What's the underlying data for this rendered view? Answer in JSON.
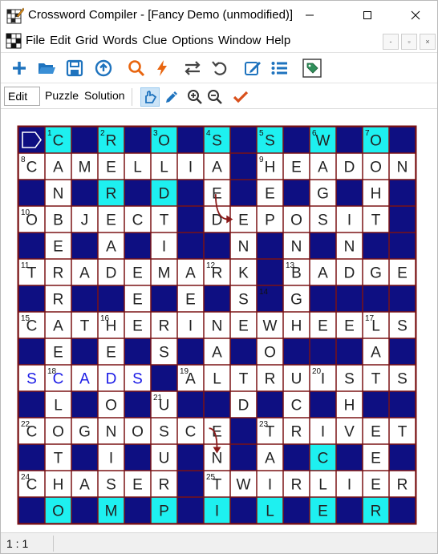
{
  "window": {
    "title": "Crossword Compiler - [Fancy Demo (unmodified)]",
    "min_glyph": "─",
    "max_glyph": "☐",
    "close_glyph": "✕"
  },
  "menu": {
    "items": [
      "File",
      "Edit",
      "Grid",
      "Words",
      "Clue",
      "Options",
      "Window",
      "Help"
    ],
    "mdi": [
      "‑",
      "▫",
      "×"
    ]
  },
  "toolbar": {
    "icons": [
      "add-icon",
      "open-folder-icon",
      "save-icon",
      "upload-icon",
      "search-icon",
      "autofill-icon",
      "swap-icon",
      "undo-icon",
      "edit-clue-icon",
      "list-icon",
      "tag-icon"
    ]
  },
  "modes": {
    "edit": "Edit",
    "puzzle": "Puzzle",
    "solution": "Solution",
    "icons": [
      "select-pointer-icon",
      "pencil-icon",
      "zoom-in-icon",
      "zoom-out-icon",
      "check-icon"
    ]
  },
  "colors": {
    "block": "#0e0f82",
    "border": "#7a1214",
    "highlight": "#1ef0f0",
    "blue_text": "#1a1ae6",
    "arrow": "#8b1a1a"
  },
  "grid": {
    "size": 15,
    "rows": [
      "#C#R#O#S#S#W#O#",
      "CAMELLIA#HEADON",
      "#N#R#D#E#E#G#H#",
      "OBJECT#DEPOSIT",
      "#E#A#I##N#N#N#",
      "TRADEMARK#BADGE",
      "#R##E#E#S#G####",
      "CATHERINEWHEELS",
      "#E#E#S#A#O###A#",
      "SCADS#ALTRUISTS",
      "#L#O#U##D#C#H#",
      "COGNOSCE#TRIVET",
      "#T#I#U#N#A#C#E#",
      "CHASER#TWIRLIER",
      "#O#M#P#I#L#E#R#"
    ],
    "numbers": [
      {
        "r": 0,
        "c": 1,
        "n": "1"
      },
      {
        "r": 0,
        "c": 3,
        "n": "2"
      },
      {
        "r": 0,
        "c": 5,
        "n": "3"
      },
      {
        "r": 0,
        "c": 7,
        "n": "4"
      },
      {
        "r": 0,
        "c": 9,
        "n": "5"
      },
      {
        "r": 0,
        "c": 11,
        "n": "6"
      },
      {
        "r": 0,
        "c": 13,
        "n": "7"
      },
      {
        "r": 1,
        "c": 0,
        "n": "8"
      },
      {
        "r": 1,
        "c": 9,
        "n": "9"
      },
      {
        "r": 3,
        "c": 0,
        "n": "10"
      },
      {
        "r": 5,
        "c": 0,
        "n": "11"
      },
      {
        "r": 5,
        "c": 7,
        "n": "12"
      },
      {
        "r": 5,
        "c": 10,
        "n": "13"
      },
      {
        "r": 6,
        "c": 9,
        "n": "14"
      },
      {
        "r": 7,
        "c": 0,
        "n": "15"
      },
      {
        "r": 7,
        "c": 3,
        "n": "16"
      },
      {
        "r": 7,
        "c": 13,
        "n": "17"
      },
      {
        "r": 9,
        "c": 1,
        "n": "18"
      },
      {
        "r": 9,
        "c": 6,
        "n": "19"
      },
      {
        "r": 9,
        "c": 11,
        "n": "20"
      },
      {
        "r": 10,
        "c": 5,
        "n": "21"
      },
      {
        "r": 11,
        "c": 0,
        "n": "22"
      },
      {
        "r": 11,
        "c": 9,
        "n": "23"
      },
      {
        "r": 13,
        "c": 0,
        "n": "24"
      },
      {
        "r": 13,
        "c": 7,
        "n": "25"
      }
    ],
    "highlighted": [
      [
        0,
        1
      ],
      [
        0,
        3
      ],
      [
        0,
        5
      ],
      [
        0,
        7
      ],
      [
        0,
        9
      ],
      [
        0,
        11
      ],
      [
        0,
        13
      ],
      [
        2,
        3
      ],
      [
        2,
        5
      ],
      [
        12,
        11
      ],
      [
        14,
        1
      ],
      [
        14,
        3
      ],
      [
        14,
        5
      ],
      [
        14,
        7
      ],
      [
        14,
        9
      ],
      [
        14,
        11
      ],
      [
        14,
        13
      ]
    ],
    "blue_cells": [
      [
        9,
        0
      ],
      [
        9,
        1
      ],
      [
        9,
        2
      ],
      [
        9,
        3
      ],
      [
        9,
        4
      ]
    ],
    "cursor_cell": [
      0,
      0
    ],
    "bend_arrows": [
      {
        "from": [
          2,
          7
        ],
        "to": [
          3,
          8
        ]
      },
      {
        "from": [
          11,
          7
        ],
        "to": [
          12,
          7
        ]
      }
    ]
  },
  "status": {
    "position": "1 : 1"
  }
}
